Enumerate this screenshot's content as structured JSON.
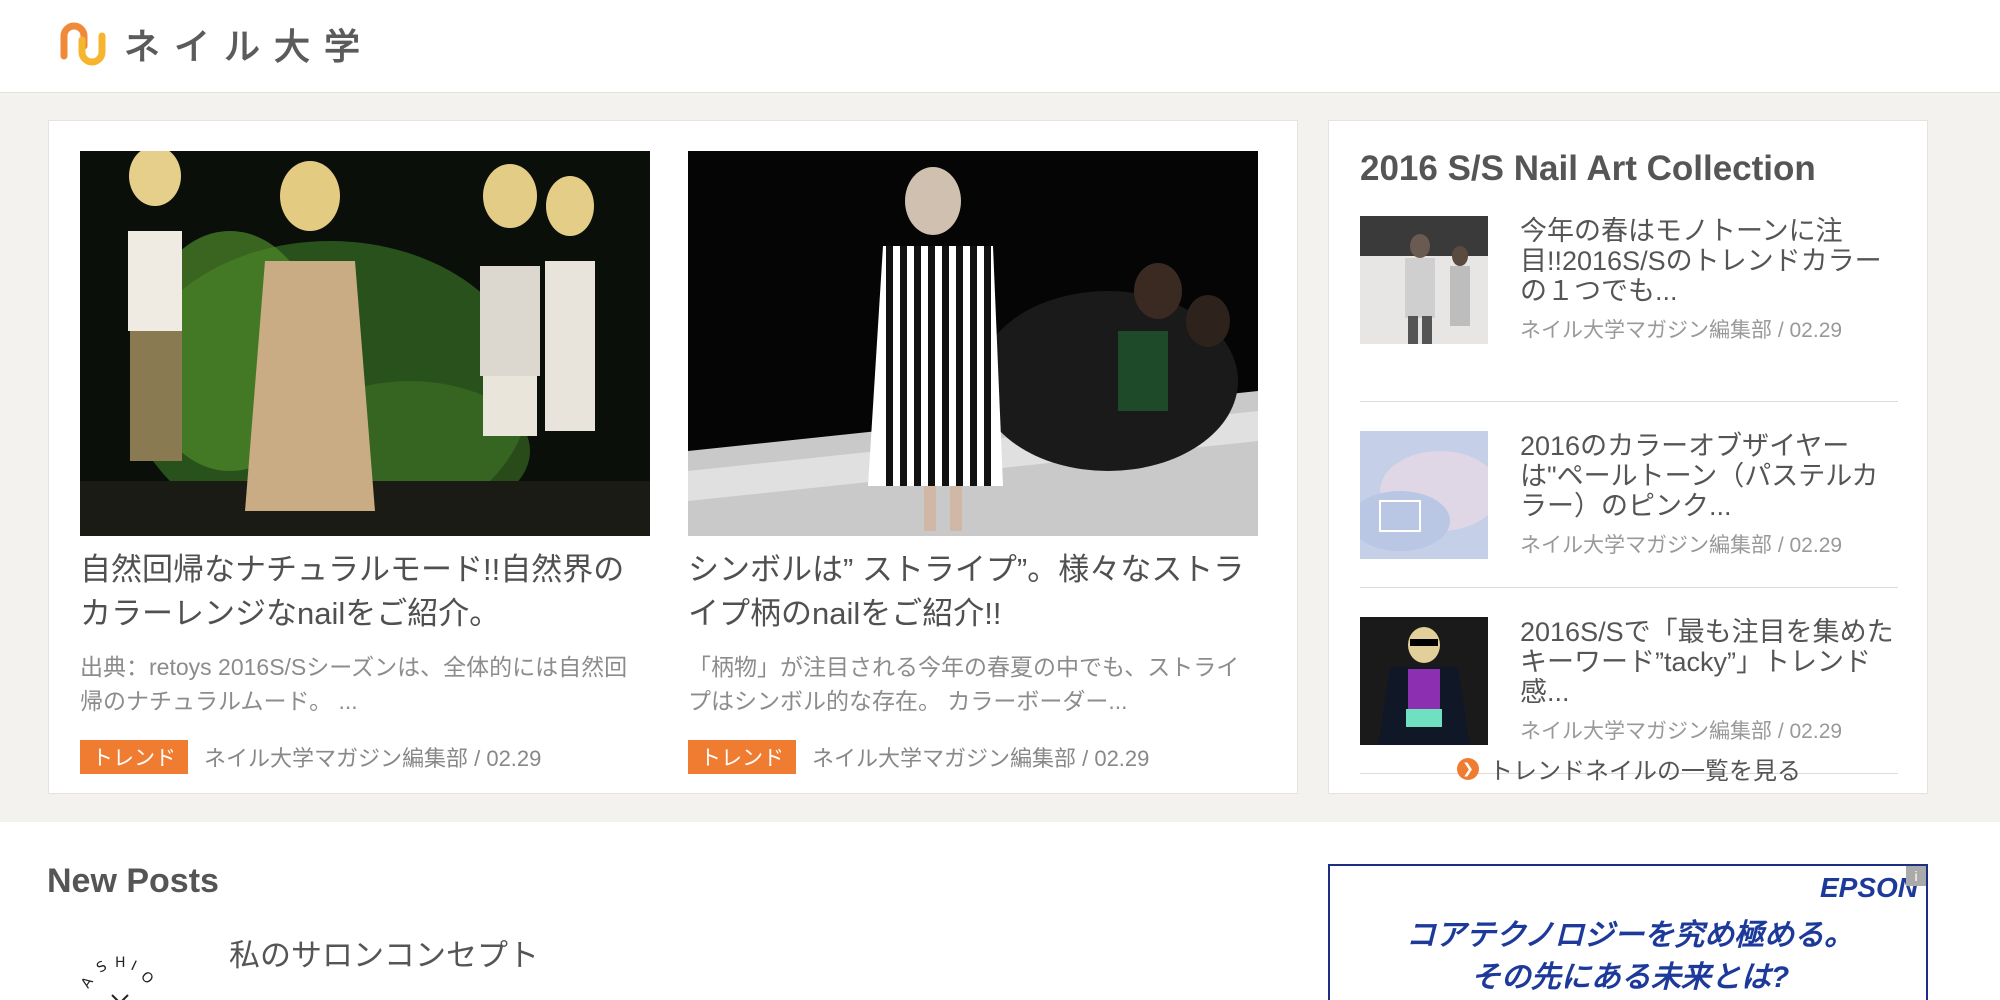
{
  "header": {
    "logo_text": "ネイル大学"
  },
  "featured": [
    {
      "title": "自然回帰なナチュラルモード!!自然界のカラーレンジなnailをご紹介。",
      "excerpt": "出典：retoys 2016S/Sシーズンは、全体的には自然回帰のナチュラルムード。 ...",
      "tag": "トレンド",
      "meta": "ネイル大学マガジン編集部 / 02.29"
    },
    {
      "title": "シンボルは” ストライプ”。様々なストライプ柄のnailをご紹介!!",
      "excerpt": "「柄物」が注目される今年の春夏の中でも、ストライプはシンボル的な存在。 カラーボーダー...",
      "tag": "トレンド",
      "meta": "ネイル大学マガジン編集部 / 02.29"
    }
  ],
  "sidebar": {
    "heading": "2016 S/S Nail Art Collection",
    "items": [
      {
        "title": "今年の春はモノトーンに注目!!2016S/Sのトレンドカラーの１つでも...",
        "meta": "ネイル大学マガジン編集部 / 02.29"
      },
      {
        "title": "2016のカラーオブザイヤーは\"ペールトーン（パステルカラー）のピンク...",
        "meta": "ネイル大学マガジン編集部 / 02.29"
      },
      {
        "title": "2016S/Sで「最も注目を集めたキーワード”tacky”」トレンド感...",
        "meta": "ネイル大学マガジン編集部 / 02.29"
      }
    ],
    "more_label": "トレンドネイルの一覧を見る"
  },
  "new_posts": {
    "heading": "New Posts",
    "first_title": "私のサロンコンセプト"
  },
  "ad": {
    "brand": "EPSON",
    "line1": "コアテクノロジーを究め極める。",
    "line2": "その先にある未来とは?",
    "info": "i"
  },
  "colors": {
    "accent": "#f07c32",
    "ad_blue": "#1d3a9b"
  }
}
